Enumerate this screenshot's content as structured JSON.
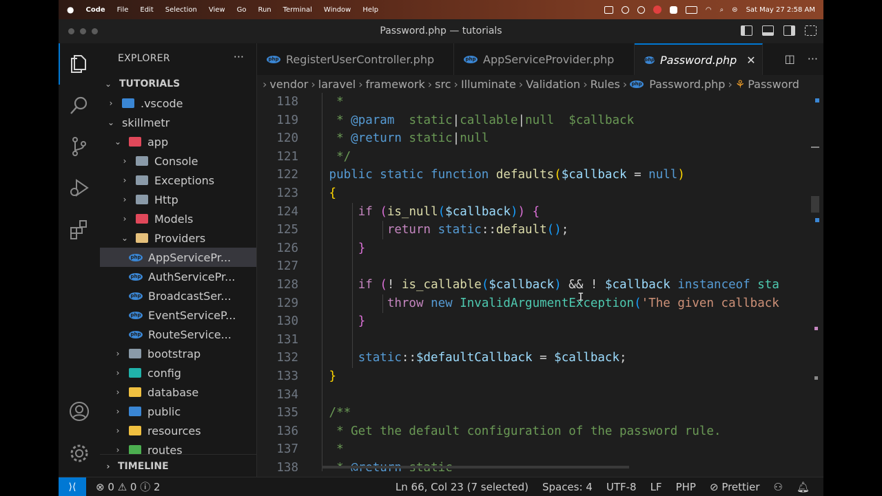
{
  "menubar": {
    "app": "Code",
    "items": [
      "File",
      "Edit",
      "Selection",
      "View",
      "Go",
      "Run",
      "Terminal",
      "Window",
      "Help"
    ],
    "clock": "Sat May 27  2:58 AM"
  },
  "window": {
    "title": "Password.php — tutorials"
  },
  "sidebar": {
    "header": "EXPLORER",
    "more": "···",
    "root": "TUTORIALS",
    "tree": [
      {
        "label": ".vscode",
        "indent": 1,
        "chev": "›",
        "icon": "vscode-folder-icon",
        "color": "#3a86d4"
      },
      {
        "label": "skillmetr",
        "indent": 1,
        "chev": "⌄",
        "icon": "none",
        "color": ""
      },
      {
        "label": "app",
        "indent": 2,
        "chev": "⌄",
        "icon": "app-folder-icon",
        "color": "#e0485a"
      },
      {
        "label": "Console",
        "indent": 3,
        "chev": "›",
        "icon": "folder-icon",
        "color": "#8a9aa8"
      },
      {
        "label": "Exceptions",
        "indent": 3,
        "chev": "›",
        "icon": "folder-icon",
        "color": "#8a9aa8"
      },
      {
        "label": "Http",
        "indent": 3,
        "chev": "›",
        "icon": "folder-icon",
        "color": "#8a9aa8"
      },
      {
        "label": "Models",
        "indent": 3,
        "chev": "›",
        "icon": "models-folder-icon",
        "color": "#e0485a"
      },
      {
        "label": "Providers",
        "indent": 3,
        "chev": "⌄",
        "icon": "providers-folder-icon",
        "color": "#e5c07b"
      },
      {
        "label": "AppServicePr...",
        "indent": 4,
        "chev": "",
        "icon": "php-file-icon",
        "color": "#3a86d4",
        "selected": true
      },
      {
        "label": "AuthServicePr...",
        "indent": 4,
        "chev": "",
        "icon": "php-file-icon",
        "color": "#3a86d4"
      },
      {
        "label": "BroadcastSer...",
        "indent": 4,
        "chev": "",
        "icon": "php-file-icon",
        "color": "#3a86d4"
      },
      {
        "label": "EventServiceP...",
        "indent": 4,
        "chev": "",
        "icon": "php-file-icon",
        "color": "#3a86d4"
      },
      {
        "label": "RouteService...",
        "indent": 4,
        "chev": "",
        "icon": "php-file-icon",
        "color": "#3a86d4"
      },
      {
        "label": "bootstrap",
        "indent": 2,
        "chev": "›",
        "icon": "folder-icon",
        "color": "#8a9aa8"
      },
      {
        "label": "config",
        "indent": 2,
        "chev": "›",
        "icon": "config-folder-icon",
        "color": "#20b2aa"
      },
      {
        "label": "database",
        "indent": 2,
        "chev": "›",
        "icon": "database-folder-icon",
        "color": "#f0c040"
      },
      {
        "label": "public",
        "indent": 2,
        "chev": "›",
        "icon": "public-folder-icon",
        "color": "#3a86d4"
      },
      {
        "label": "resources",
        "indent": 2,
        "chev": "›",
        "icon": "resources-folder-icon",
        "color": "#f0c040"
      },
      {
        "label": "routes",
        "indent": 2,
        "chev": "›",
        "icon": "routes-folder-icon",
        "color": "#4caf50"
      }
    ],
    "timeline": "TIMELINE"
  },
  "tabs": [
    {
      "label": "RegisterUserController.php",
      "active": false
    },
    {
      "label": "AppServiceProvider.php",
      "active": false
    },
    {
      "label": "Password.php",
      "active": true
    }
  ],
  "breadcrumbs": [
    "vendor",
    "laravel",
    "framework",
    "src",
    "Illuminate",
    "Validation",
    "Rules",
    "Password.php",
    "Password"
  ],
  "code": {
    "lines": [
      {
        "n": "118",
        "tokens": [
          [
            "  *",
            "c-com"
          ]
        ]
      },
      {
        "n": "119",
        "tokens": [
          [
            "  * ",
            "c-com"
          ],
          [
            "@param",
            "c-doc"
          ],
          [
            "  static",
            "c-com"
          ],
          [
            "|",
            "c-op"
          ],
          [
            "callable",
            "c-com"
          ],
          [
            "|",
            "c-op"
          ],
          [
            "null",
            "c-com"
          ],
          [
            "  $callback",
            "c-com"
          ]
        ]
      },
      {
        "n": "120",
        "tokens": [
          [
            "  * ",
            "c-com"
          ],
          [
            "@return",
            "c-doc"
          ],
          [
            " static",
            "c-com"
          ],
          [
            "|",
            "c-op"
          ],
          [
            "null",
            "c-com"
          ]
        ]
      },
      {
        "n": "121",
        "tokens": [
          [
            "  */",
            "c-com"
          ]
        ]
      },
      {
        "n": "122",
        "tokens": [
          [
            " public static function ",
            "c-kw"
          ],
          [
            "defaults",
            "c-fn"
          ],
          [
            "(",
            "c-p1"
          ],
          [
            "$callback",
            "c-var"
          ],
          [
            " = ",
            "c-op"
          ],
          [
            "null",
            "c-kw"
          ],
          [
            ")",
            "c-p1"
          ]
        ]
      },
      {
        "n": "123",
        "tokens": [
          [
            " {",
            "c-p1"
          ]
        ]
      },
      {
        "n": "124",
        "tokens": [
          [
            "     ",
            "c-op"
          ],
          [
            "if",
            "c-ctl"
          ],
          [
            " ",
            "c-op"
          ],
          [
            "(",
            "c-p2"
          ],
          [
            "is_null",
            "c-fn"
          ],
          [
            "(",
            "c-p3"
          ],
          [
            "$callback",
            "c-var"
          ],
          [
            ")",
            "c-p3"
          ],
          [
            ")",
            "c-p2"
          ],
          [
            " ",
            "c-op"
          ],
          [
            "{",
            "c-p2"
          ]
        ]
      },
      {
        "n": "125",
        "tokens": [
          [
            "         ",
            "c-op"
          ],
          [
            "return",
            "c-ctl"
          ],
          [
            " ",
            "c-op"
          ],
          [
            "static",
            "c-kw"
          ],
          [
            "::",
            "c-op"
          ],
          [
            "default",
            "c-fn"
          ],
          [
            "(",
            "c-p3"
          ],
          [
            ")",
            "c-p3"
          ],
          [
            ";",
            "c-op"
          ]
        ]
      },
      {
        "n": "126",
        "tokens": [
          [
            "     ",
            "c-op"
          ],
          [
            "}",
            "c-p2"
          ]
        ]
      },
      {
        "n": "127",
        "tokens": []
      },
      {
        "n": "128",
        "tokens": [
          [
            "     ",
            "c-op"
          ],
          [
            "if",
            "c-ctl"
          ],
          [
            " ",
            "c-op"
          ],
          [
            "(",
            "c-p2"
          ],
          [
            "! ",
            "c-op"
          ],
          [
            "is_callable",
            "c-fn"
          ],
          [
            "(",
            "c-p3"
          ],
          [
            "$callback",
            "c-var"
          ],
          [
            ")",
            "c-p3"
          ],
          [
            " && ! ",
            "c-op"
          ],
          [
            "$callback",
            "c-var"
          ],
          [
            " instanceof ",
            "c-kw"
          ],
          [
            "sta",
            "c-cls"
          ]
        ]
      },
      {
        "n": "129",
        "tokens": [
          [
            "         ",
            "c-op"
          ],
          [
            "throw",
            "c-ctl"
          ],
          [
            " ",
            "c-op"
          ],
          [
            "new",
            "c-kw"
          ],
          [
            " ",
            "c-op"
          ],
          [
            "InvalidArgumentException",
            "c-cls"
          ],
          [
            "(",
            "c-p3"
          ],
          [
            "'The given callback",
            "c-str"
          ]
        ]
      },
      {
        "n": "130",
        "tokens": [
          [
            "     ",
            "c-op"
          ],
          [
            "}",
            "c-p2"
          ]
        ]
      },
      {
        "n": "131",
        "tokens": []
      },
      {
        "n": "132",
        "tokens": [
          [
            "     ",
            "c-op"
          ],
          [
            "static",
            "c-kw"
          ],
          [
            "::",
            "c-op"
          ],
          [
            "$defaultCallback",
            "c-var"
          ],
          [
            " = ",
            "c-op"
          ],
          [
            "$callback",
            "c-var"
          ],
          [
            ";",
            "c-op"
          ]
        ]
      },
      {
        "n": "133",
        "tokens": [
          [
            " }",
            "c-p1"
          ]
        ]
      },
      {
        "n": "134",
        "tokens": []
      },
      {
        "n": "135",
        "tokens": [
          [
            " /**",
            "c-com"
          ]
        ]
      },
      {
        "n": "136",
        "tokens": [
          [
            "  * Get the default configuration of the password rule.",
            "c-com"
          ]
        ]
      },
      {
        "n": "137",
        "tokens": [
          [
            "  *",
            "c-com"
          ]
        ]
      },
      {
        "n": "138",
        "tokens": [
          [
            "  * ",
            "c-com"
          ],
          [
            "@return",
            "c-doc"
          ],
          [
            " static",
            "c-com"
          ]
        ]
      }
    ]
  },
  "status": {
    "remote": "⟩⟨",
    "errors": "0",
    "warnings": "0",
    "info": "2",
    "position": "Ln 66, Col 23 (7 selected)",
    "spaces": "Spaces: 4",
    "encoding": "UTF-8",
    "eol": "LF",
    "language": "PHP",
    "formatter": "Prettier"
  }
}
